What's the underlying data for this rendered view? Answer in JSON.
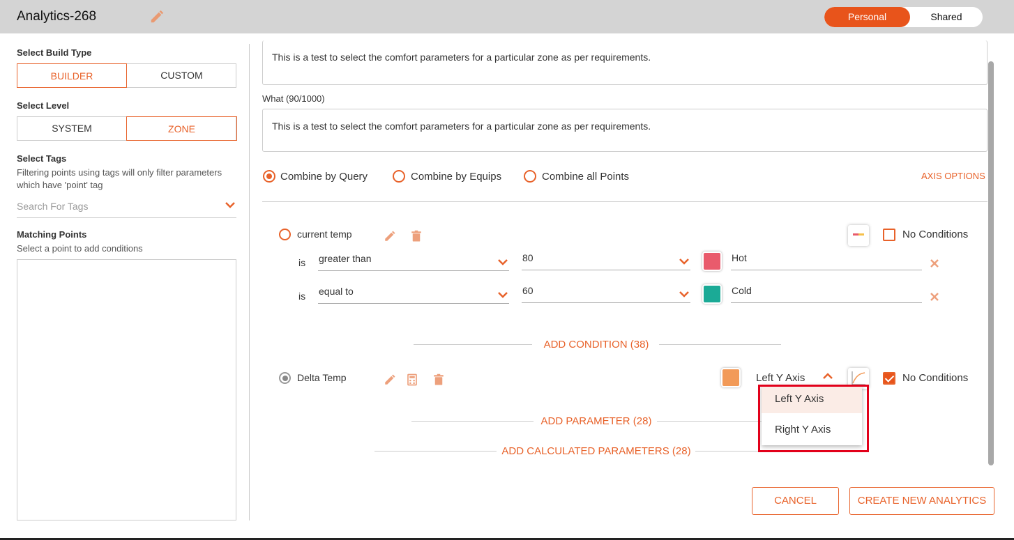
{
  "header": {
    "title": "Analytics-268",
    "toggle": {
      "personal": "Personal",
      "shared": "Shared",
      "active": "Personal"
    }
  },
  "sidebar": {
    "build_type": {
      "label": "Select Build Type",
      "options": [
        "BUILDER",
        "CUSTOM"
      ],
      "active": "BUILDER"
    },
    "level": {
      "label": "Select Level",
      "options": [
        "SYSTEM",
        "ZONE"
      ],
      "active": "ZONE"
    },
    "tags": {
      "label": "Select Tags",
      "help": "Filtering points using tags will only filter parameters which have 'point' tag",
      "placeholder": "Search For Tags"
    },
    "matching": {
      "label": "Matching Points",
      "help": "Select a point to add conditions"
    }
  },
  "main": {
    "why_text": "This is a test to select the comfort parameters for a particular zone as per requirements.",
    "what_label": "What (90/1000)",
    "what_text": "This is a test to select the comfort parameters for a particular zone as per requirements.",
    "combine": {
      "options": [
        "Combine by Query",
        "Combine by Equips",
        "Combine all Points"
      ],
      "selected": "Combine by Query"
    },
    "axis_options": "AXIS OPTIONS",
    "params": [
      {
        "name": "current temp",
        "no_conditions_label": "No Conditions",
        "no_conditions_checked": false,
        "conditions": [
          {
            "is": "is",
            "operator": "greater than",
            "value": "80",
            "color": "#e95b6c",
            "label": "Hot"
          },
          {
            "is": "is",
            "operator": "equal to",
            "value": "60",
            "color": "#1baa96",
            "label": "Cold"
          }
        ]
      },
      {
        "name": "Delta Temp",
        "color": "#f29a58",
        "axis": "Left Y Axis",
        "no_conditions_label": "No Conditions",
        "no_conditions_checked": true
      }
    ],
    "add_condition": "ADD CONDITION (38)",
    "add_parameter": "ADD PARAMETER (28)",
    "add_calculated": "ADD CALCULATED PARAMETERS (28)",
    "axis_dropdown": {
      "options": [
        "Left Y Axis",
        "Right Y Axis"
      ],
      "selected": "Left Y Axis"
    },
    "buttons": {
      "cancel": "CANCEL",
      "create": "CREATE NEW ANALYTICS"
    }
  },
  "colors": {
    "accent": "#e8622a",
    "header_bg": "#d4d4d4",
    "highlight": "#e2001a"
  }
}
